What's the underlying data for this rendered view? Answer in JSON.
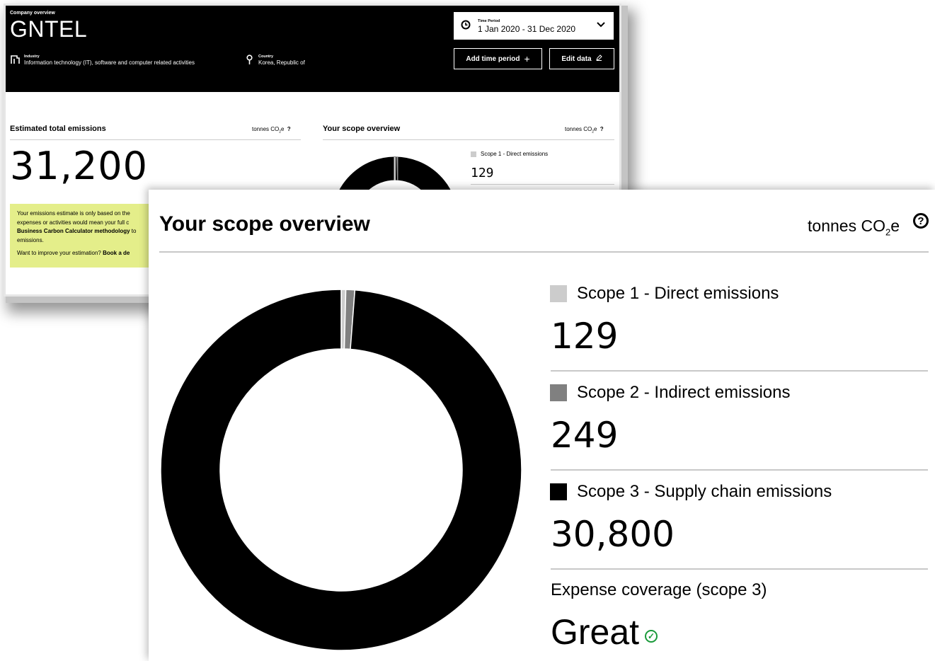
{
  "header": {
    "eyebrow": "Company overview",
    "company": "GNTEL",
    "industry_label": "Industry",
    "industry_value": "Information technology (IT), software and computer related activities",
    "country_label": "Country",
    "country_value": "Korea, Republic of",
    "period_label": "Time Period",
    "period_value": "1 Jan 2020 - 31 Dec 2020",
    "add_period_label": "Add time period",
    "edit_data_label": "Edit data"
  },
  "totals": {
    "title": "Estimated total emissions",
    "unit_prefix": "tonnes CO",
    "unit_sub": "2",
    "unit_suffix": "e",
    "value": "31,200"
  },
  "notice": {
    "text_1": "Your emissions estimate is only based on the",
    "text_2": "expenses or activities would mean your full c",
    "text_3_bold": "Business Carbon Calculator methodology",
    "text_3": " to",
    "text_4": "emissions.",
    "improve": "Want to improve your estimation? ",
    "improve_link": "Book a de"
  },
  "scope_small": {
    "title": "Your scope overview",
    "unit_prefix": "tonnes CO",
    "unit_sub": "2",
    "unit_suffix": "e",
    "scope1_label": "Scope 1 - Direct emissions",
    "scope1_value": "129"
  },
  "scope": {
    "title": "Your scope overview",
    "unit_prefix": "tonnes CO",
    "unit_sub": "2",
    "unit_suffix": "e",
    "help_icon": "question-circle-icon",
    "items": [
      {
        "label": "Scope 1 - Direct emissions",
        "value": "129",
        "color": "#cccccc"
      },
      {
        "label": "Scope 2 - Indirect emissions",
        "value": "249",
        "color": "#808080"
      },
      {
        "label": "Scope 3 - Supply chain emissions",
        "value": "30,800",
        "color": "#000000"
      }
    ],
    "coverage_label": "Expense coverage (scope 3)",
    "coverage_value": "Great",
    "coverage_color": "#1a9a3a"
  },
  "chart_data": {
    "type": "pie",
    "categories": [
      "Scope 1 - Direct emissions",
      "Scope 2 - Indirect emissions",
      "Scope 3 - Supply chain emissions"
    ],
    "values": [
      129,
      249,
      30800
    ],
    "colors": [
      "#cccccc",
      "#808080",
      "#000000"
    ]
  }
}
